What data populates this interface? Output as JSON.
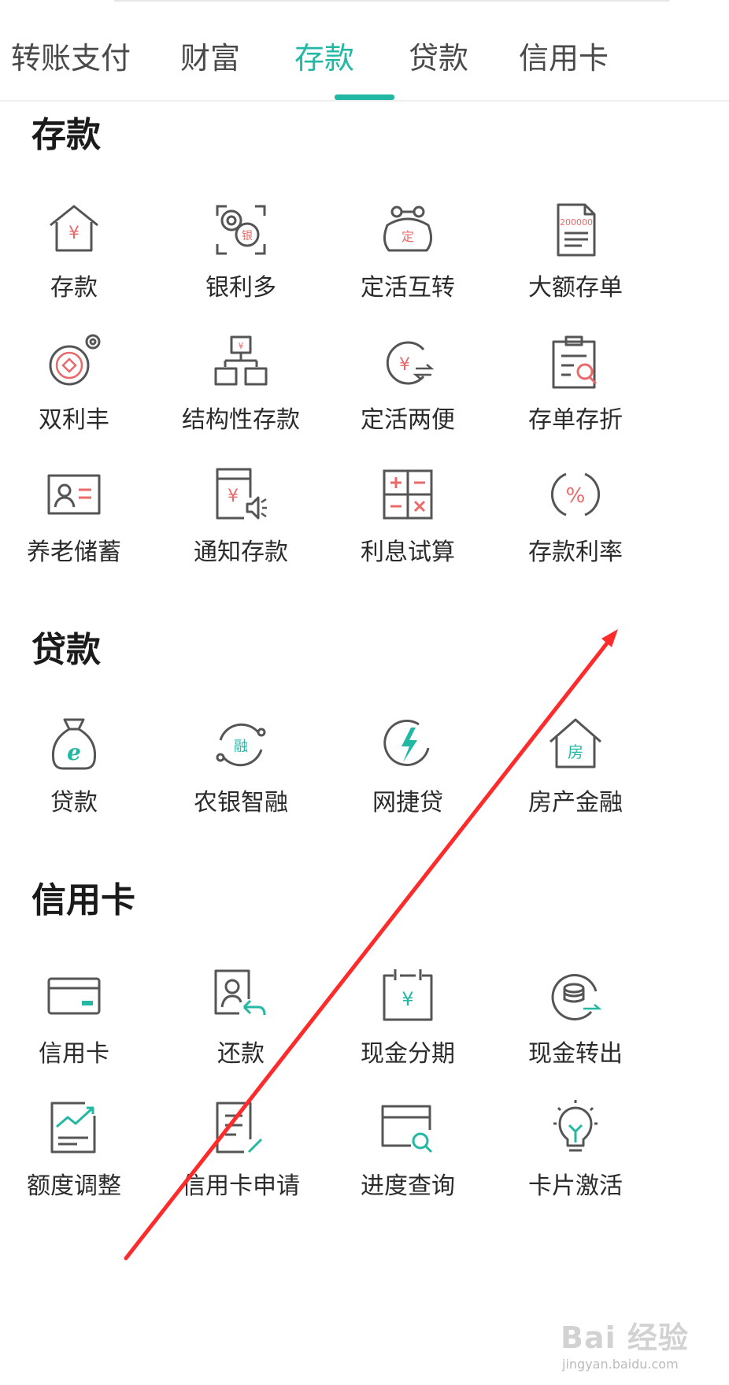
{
  "tabs": [
    "转账支付",
    "财富",
    "存款",
    "贷款",
    "信用卡"
  ],
  "active_tab": "存款",
  "sections": {
    "deposit": {
      "title": "存款",
      "items": [
        "存款",
        "银利多",
        "定活互转",
        "大额存单",
        "双利丰",
        "结构性存款",
        "定活两便",
        "存单存折",
        "养老储蓄",
        "通知存款",
        "利息试算",
        "存款利率"
      ]
    },
    "loan": {
      "title": "贷款",
      "items": [
        "贷款",
        "农银智融",
        "网捷贷",
        "房产金融"
      ]
    },
    "credit": {
      "title": "信用卡",
      "items": [
        "信用卡",
        "还款",
        "现金分期",
        "现金转出",
        "额度调整",
        "信用卡申请",
        "进度查询",
        "卡片激活"
      ]
    }
  },
  "icon_text": {
    "yen": "¥",
    "yin": "银",
    "ding": "定",
    "amount": "200000",
    "rong": "融",
    "fang": "房",
    "percent": "%",
    "e": "e"
  },
  "watermark": {
    "main": "Bai 经验",
    "sub": "jingyan.baidu.com"
  },
  "colors": {
    "accent": "#23b8a4",
    "icon_red": "#e86a6a",
    "annotation_arrow": "#ff2a2a"
  }
}
